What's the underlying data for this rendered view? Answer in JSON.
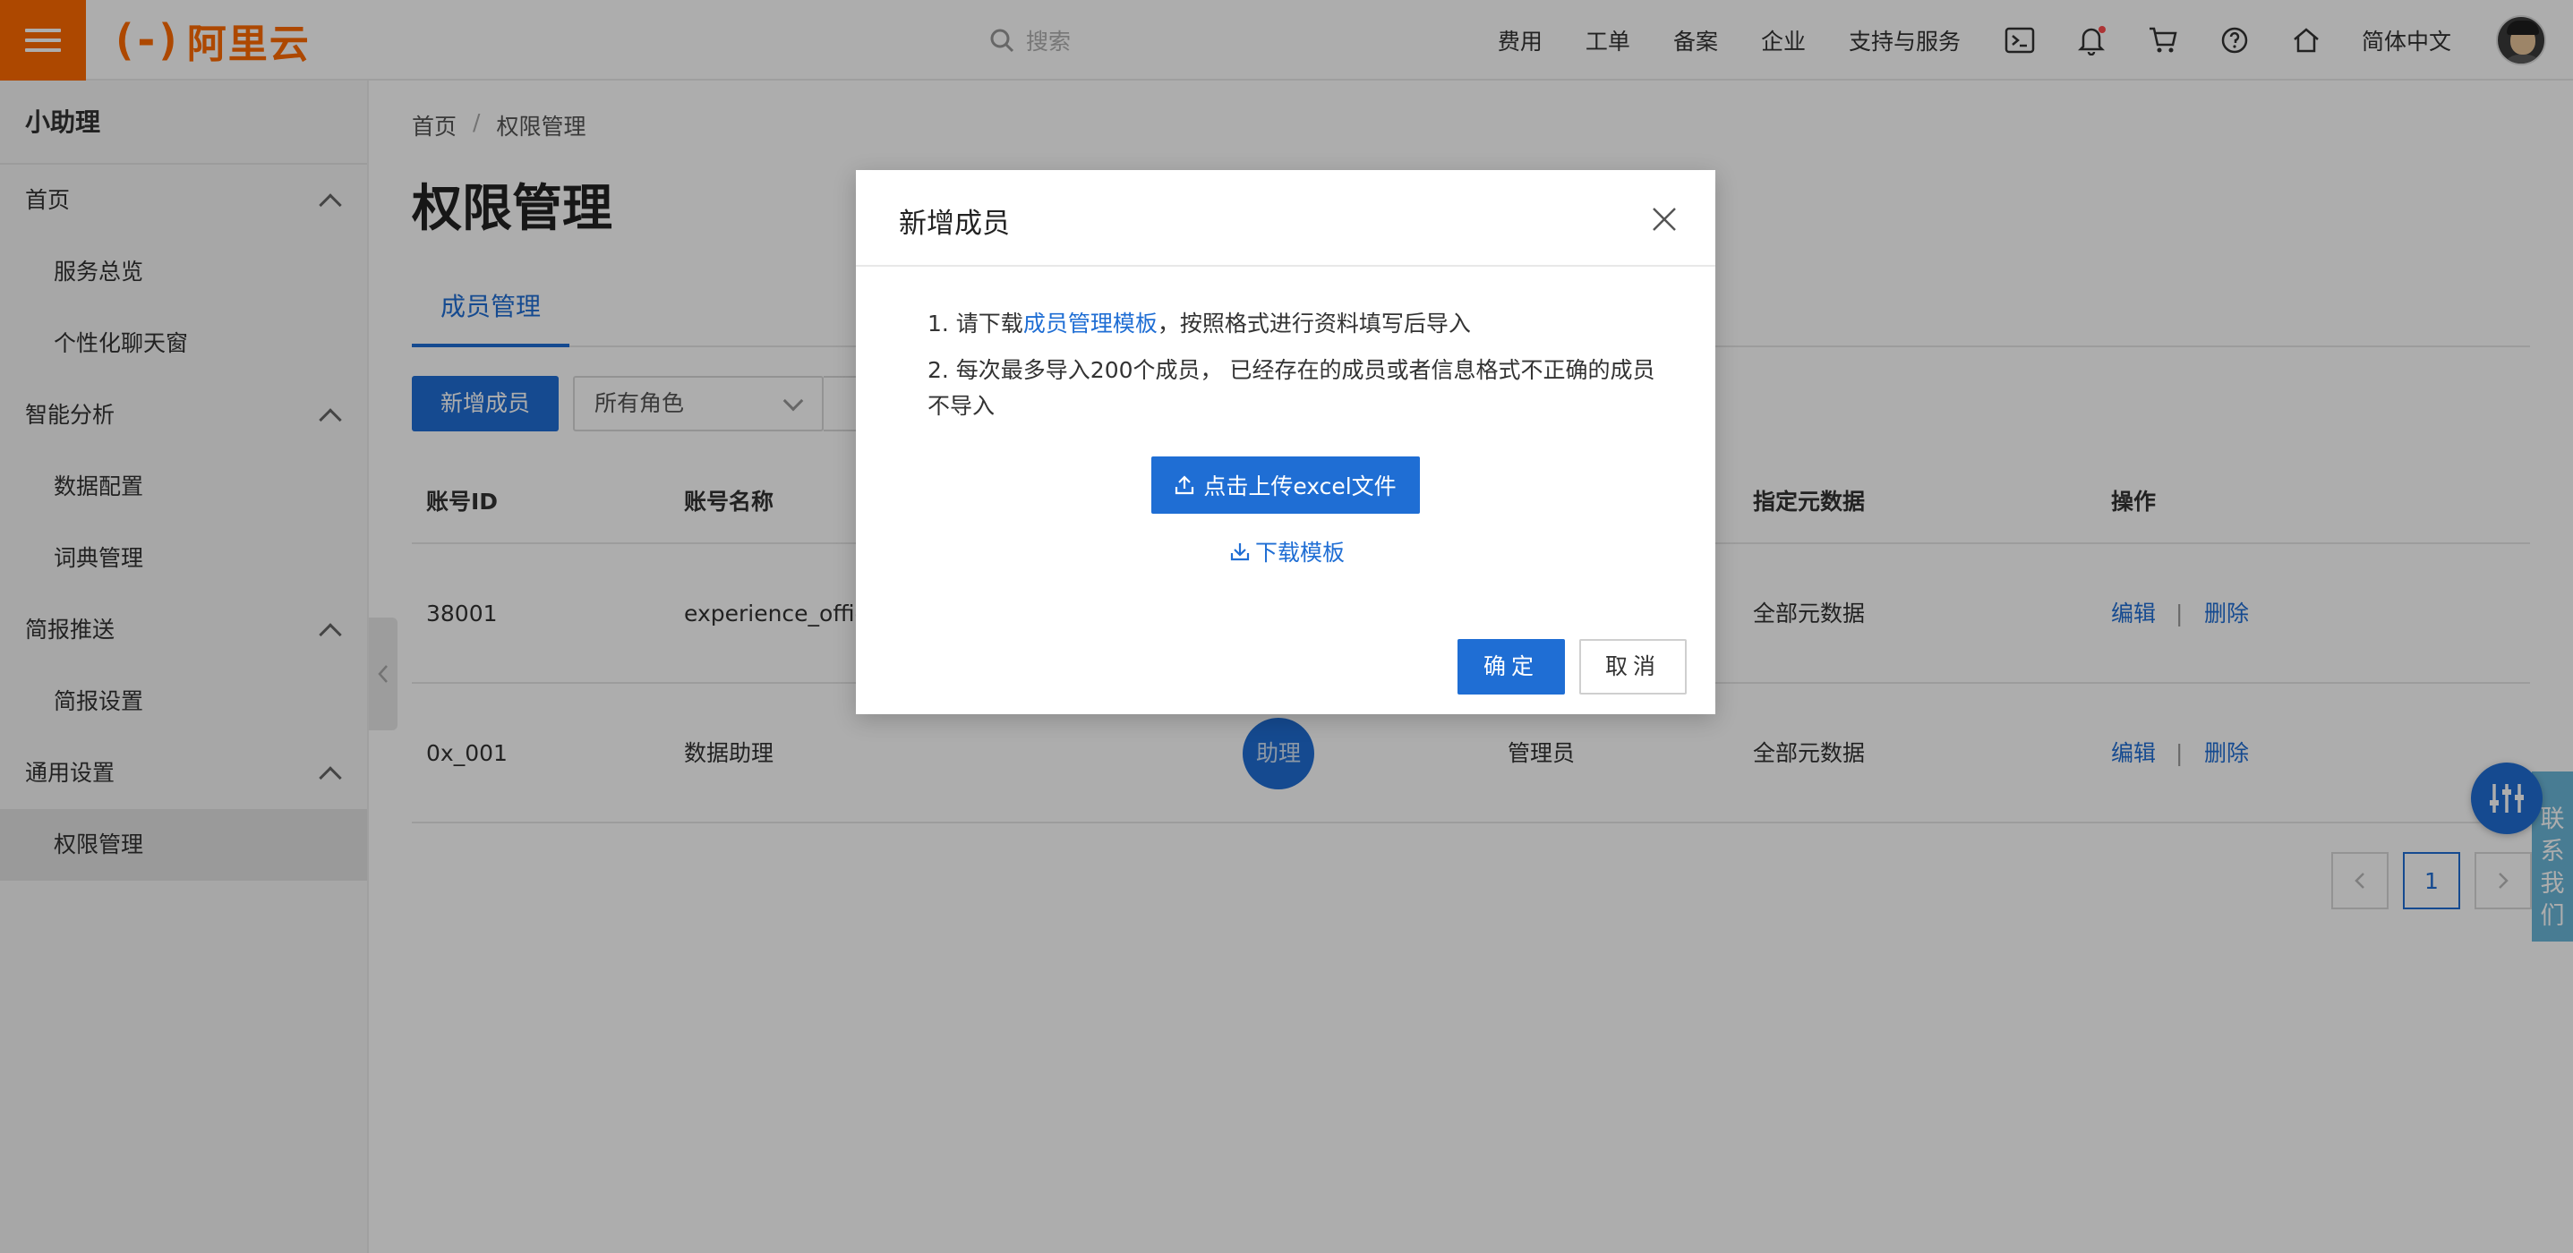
{
  "header": {
    "logo_mark": "(-)",
    "logo_text": "阿里云",
    "search_placeholder": "搜索",
    "nav": [
      "费用",
      "工单",
      "备案",
      "企业",
      "支持与服务"
    ],
    "language": "简体中文",
    "brand_color": "#ff6a00"
  },
  "sidebar": {
    "title": "小助理",
    "groups": [
      {
        "label": "首页",
        "items": [
          "服务总览",
          "个性化聊天窗"
        ]
      },
      {
        "label": "智能分析",
        "items": [
          "数据配置",
          "词典管理"
        ]
      },
      {
        "label": "简报推送",
        "items": [
          "简报设置"
        ]
      },
      {
        "label": "通用设置",
        "items": [
          "权限管理"
        ]
      }
    ],
    "active_item": "权限管理"
  },
  "breadcrumb": [
    "首页",
    "权限管理"
  ],
  "page_title": "权限管理",
  "tabs": [
    "成员管理"
  ],
  "toolbar": {
    "add_member": "新增成员",
    "role_filter": "所有角色"
  },
  "table": {
    "headers": [
      "账号ID",
      "账号名称",
      "指定元数据",
      "操作"
    ],
    "rows": [
      {
        "id": "38001",
        "name": "experience_office",
        "role": "",
        "avatar": "",
        "metadata": "全部元数据",
        "edit": "编辑",
        "delete": "删除"
      },
      {
        "id": "0x_001",
        "name": "数据助理",
        "role": "管理员",
        "avatar": "助理",
        "metadata": "全部元数据",
        "edit": "编辑",
        "delete": "删除"
      }
    ],
    "op_separator": "|"
  },
  "pagination": {
    "current": "1"
  },
  "contact": "联系我们",
  "modal": {
    "title": "新增成员",
    "line1_prefix": "1. 请下载",
    "line1_link": "成员管理模板",
    "line1_suffix": "，按照格式进行资料填写后导入",
    "line2": "2. 每次最多导入200个成员， 已经存在的成员或者信息格式不正确的成员不导入",
    "upload_button": "点击上传excel文件",
    "download_link": "下载模板",
    "ok_button": "确定",
    "cancel_button": "取消"
  },
  "accent_color": "#1f6ed4"
}
